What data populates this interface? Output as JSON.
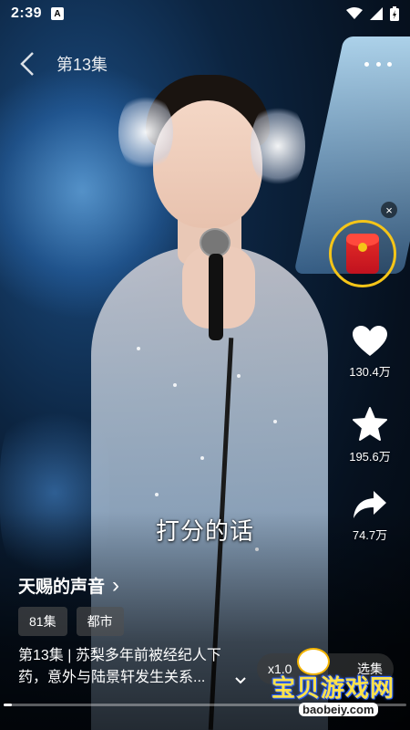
{
  "status_bar": {
    "time": "2:39",
    "notif_badge": "A",
    "icons": [
      "wifi-icon",
      "signal-icon",
      "battery-icon"
    ]
  },
  "top_bar": {
    "episode_title": "第13集",
    "back_icon": "chevron-left-icon",
    "more_icon": "more-dots-icon"
  },
  "side_actions": {
    "redpacket_icon": "red-envelope-icon",
    "close_icon": "close-icon",
    "close_symbol": "×",
    "like": {
      "icon": "heart-icon",
      "count": "130.4万"
    },
    "favorite": {
      "icon": "star-icon",
      "count": "195.6万"
    },
    "share": {
      "icon": "share-arrow-icon",
      "count": "74.7万"
    }
  },
  "subtitle": "打分的话",
  "drama": {
    "title": "天赐的声音",
    "title_chevron": "›",
    "tags": [
      "81集",
      "都市"
    ],
    "description_line1": "第13集 | 苏梨多年前被经纪人下",
    "description_line2": "药，意外与陆景轩发生关系...",
    "expand_icon": "chevron-down-icon"
  },
  "controls": {
    "speed": "x1.0",
    "select_episode": "选集"
  },
  "playback": {
    "progress_fraction": 0.02
  },
  "watermark": {
    "text": "宝贝游戏网",
    "url": "baobeiy.com"
  },
  "colors": {
    "accent_gold": "#f5c518",
    "redpacket": "#e52d27"
  }
}
